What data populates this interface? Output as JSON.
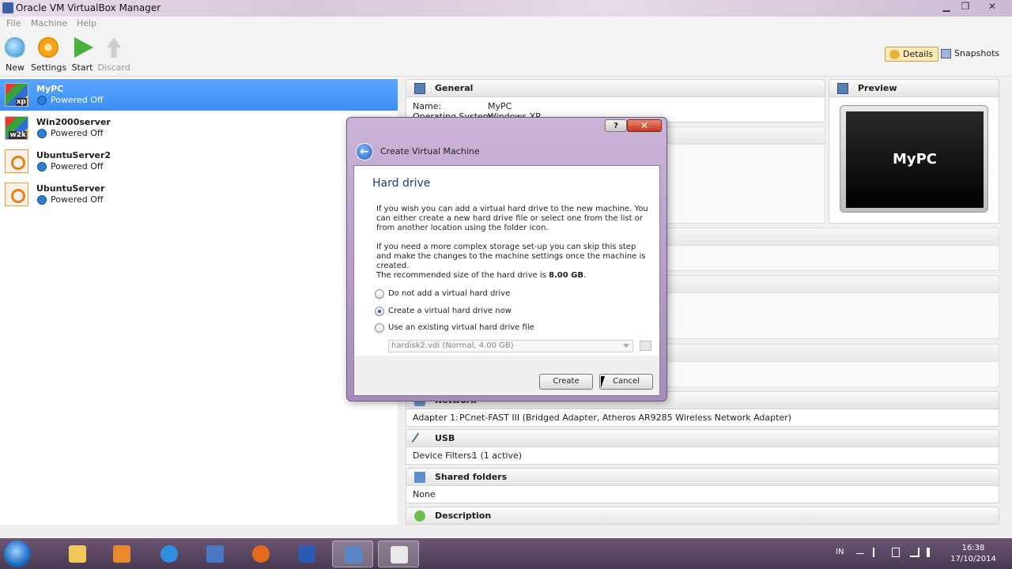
{
  "window": {
    "title": "Oracle VM VirtualBox Manager",
    "minimize": "▁",
    "maximize": "❐",
    "close": "✕"
  },
  "menu": {
    "file": "File",
    "machine": "Machine",
    "help": "Help"
  },
  "toolbar": {
    "new_label": "New",
    "settings_label": "Settings",
    "start_label": "Start",
    "discard_label": "Discard",
    "details_label": "Details",
    "snapshots_label": "Snapshots"
  },
  "vms": [
    {
      "name": "MyPC",
      "state": "Powered Off",
      "os_badge": "xp"
    },
    {
      "name": "Win2000server",
      "state": "Powered Off",
      "os_badge": "w2k"
    },
    {
      "name": "UbuntuServer2",
      "state": "Powered Off",
      "os_badge": ""
    },
    {
      "name": "UbuntuServer",
      "state": "Powered Off",
      "os_badge": ""
    }
  ],
  "details": {
    "general_title": "General",
    "general": {
      "name_key": "Name:",
      "name_val": "MyPC",
      "os_key": "Operating System:",
      "os_val": "Windows XP"
    },
    "preview_title": "Preview",
    "preview_text": "MyPC",
    "network": {
      "title": "Network",
      "adapter_key": "Adapter 1:",
      "adapter_val": "PCnet-FAST III (Bridged Adapter, Atheros AR9285 Wireless Network Adapter)"
    },
    "usb": {
      "title": "USB",
      "filters_key": "Device Filters:",
      "filters_val": "1 (1 active)"
    },
    "shared": {
      "title": "Shared folders",
      "value": "None"
    },
    "description": {
      "title": "Description"
    }
  },
  "dialog": {
    "help_label": "?",
    "close_label": "✕",
    "title": "Create Virtual Machine",
    "page_title": "Hard drive",
    "para1": "If you wish you can add a virtual hard drive to the new machine. You can either create a new hard drive file or select one from the list or from another location using the folder icon.",
    "para2": "If you need a more complex storage set-up you can skip this step and make the changes to the machine settings once the machine is created.",
    "recommended_prefix": "The recommended size of the hard drive is ",
    "recommended_size": "8.00 GB",
    "recommended_suffix": ".",
    "options": [
      {
        "label": "Do not add a virtual hard drive",
        "checked": false
      },
      {
        "label": "Create a virtual hard drive now",
        "checked": true
      },
      {
        "label": "Use an existing virtual hard drive file",
        "checked": false
      }
    ],
    "existing_file": "hardisk2.vdi (Normal, 4.00 GB)",
    "create_label": "Create",
    "cancel_label": "Cancel"
  },
  "taskbar": {
    "apps": [
      "file-explorer",
      "media-player",
      "internet-explorer",
      "app-4",
      "firefox",
      "word",
      "virtualbox",
      "notepad"
    ],
    "language": "IN",
    "time": "16:38",
    "date": "17/10/2014"
  },
  "colors": {
    "selection": "#3d8ef5",
    "dialog_frame": "#b49bc6",
    "accent_text": "#1a3d7a"
  }
}
